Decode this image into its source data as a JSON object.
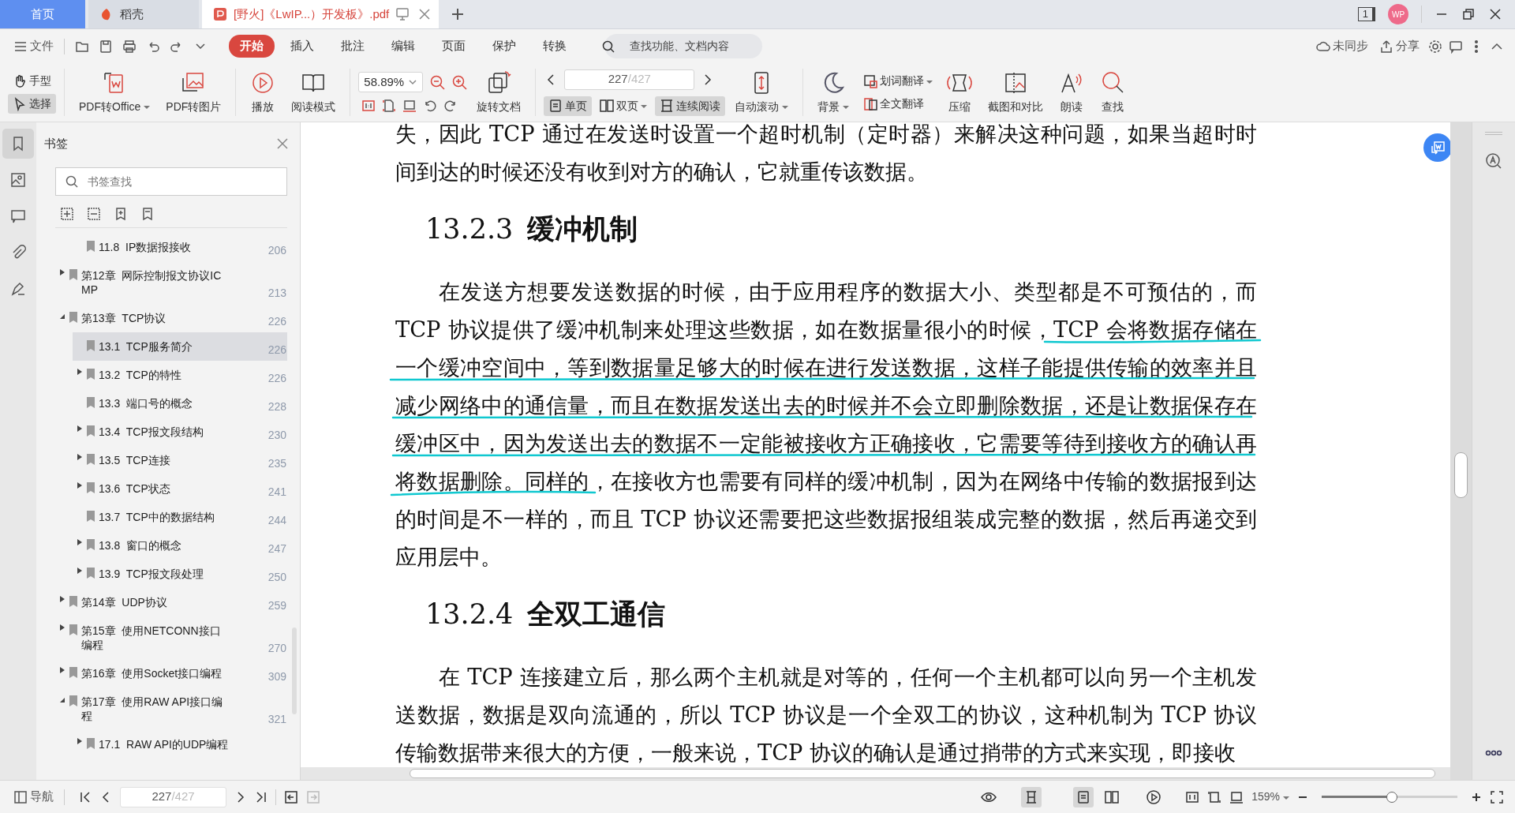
{
  "tabs": [
    {
      "label": "首页",
      "selected": false,
      "kind": "home"
    },
    {
      "label": "稻壳",
      "selected": false,
      "kind": "app"
    },
    {
      "label": "[野火]《LwIP...）开发板》.pdf",
      "selected": true,
      "kind": "pdf"
    }
  ],
  "title_bar": {
    "window_count": "1",
    "avatar": "WP"
  },
  "menu": {
    "file": "文件",
    "tabs": [
      {
        "label": "开始",
        "selected": true
      },
      {
        "label": "插入",
        "selected": false
      },
      {
        "label": "批注",
        "selected": false
      },
      {
        "label": "编辑",
        "selected": false
      },
      {
        "label": "页面",
        "selected": false
      },
      {
        "label": "保护",
        "selected": false
      },
      {
        "label": "转换",
        "selected": false
      }
    ],
    "search": {
      "placeholder": "查找功能、文档内容"
    },
    "sync": "未同步",
    "share": "分享"
  },
  "toolbar": {
    "modes": [
      {
        "label": "手型",
        "selected": false
      },
      {
        "label": "选择",
        "selected": true
      }
    ],
    "actions": [
      {
        "label": "PDF转Office",
        "dropdown": true
      },
      {
        "label": "PDF转图片",
        "dropdown": false
      },
      {
        "label": "播放",
        "dropdown": false
      },
      {
        "label": "阅读模式",
        "dropdown": false
      }
    ],
    "zoom": "58.89%",
    "rotate": "旋转文档",
    "page": {
      "current": "227",
      "total": "/427"
    },
    "views": [
      {
        "label": "单页",
        "selected": true,
        "dropdown": false
      },
      {
        "label": "双页",
        "selected": false,
        "dropdown": true
      },
      {
        "label": "连续阅读",
        "selected": true,
        "dropdown": false
      }
    ],
    "tools": [
      {
        "label": "自动滚动",
        "dropdown": true
      },
      {
        "label": "背景",
        "dropdown": true
      }
    ],
    "translate": [
      {
        "label": "划词翻译",
        "dropdown": true
      },
      {
        "label": "全文翻译",
        "dropdown": false
      }
    ],
    "extras": [
      {
        "label": "压缩"
      },
      {
        "label": "截图和对比"
      },
      {
        "label": "朗读"
      },
      {
        "label": "查找"
      }
    ]
  },
  "rail": [
    {
      "selected": true
    },
    {
      "selected": false
    },
    {
      "selected": false
    },
    {
      "selected": false
    },
    {
      "selected": false
    }
  ],
  "sidebar": {
    "title": "书签",
    "search": {
      "placeholder": "书签查找"
    },
    "orphan_items": [
      {
        "label": "11.8  IP数据报接收",
        "page": "206",
        "selected": false
      }
    ],
    "items": [
      {
        "label": "第12章  网际控制报文协议ICMP",
        "page": "213",
        "selected": false,
        "expanded": false
      },
      {
        "label": "第13章  TCP协议",
        "page": "226",
        "selected": false,
        "expanded": true,
        "children": [
          {
            "label": "13.1  TCP服务简介",
            "page": "226",
            "selected": true
          },
          {
            "label": "13.2  TCP的特性",
            "page": "226",
            "selected": false,
            "expanded": false
          },
          {
            "label": "13.3  端口号的概念",
            "page": "228",
            "selected": false
          },
          {
            "label": "13.4  TCP报文段结构",
            "page": "230",
            "selected": false,
            "expanded": false
          },
          {
            "label": "13.5  TCP连接",
            "page": "235",
            "selected": false,
            "expanded": false
          },
          {
            "label": "13.6  TCP状态",
            "page": "241",
            "selected": false,
            "expanded": false
          },
          {
            "label": "13.7  TCP中的数据结构",
            "page": "244",
            "selected": false
          },
          {
            "label": "13.8  窗口的概念",
            "page": "247",
            "selected": false,
            "expanded": false
          },
          {
            "label": "13.9  TCP报文段处理",
            "page": "250",
            "selected": false,
            "expanded": false
          }
        ]
      },
      {
        "label": "第14章  UDP协议",
        "page": "259",
        "selected": false,
        "expanded": false
      },
      {
        "label": "第15章  使用NETCONN接口编程",
        "page": "270",
        "selected": false,
        "expanded": false
      },
      {
        "label": "第16章  使用Socket接口编程",
        "page": "309",
        "selected": false,
        "expanded": false
      },
      {
        "label": "第17章  使用RAW API接口编程",
        "page": "321",
        "selected": false,
        "expanded": true,
        "children": [
          {
            "label": "17.1  RAW API的UDP编程",
            "selected": false,
            "expanded": false
          }
        ]
      }
    ]
  },
  "document": {
    "blocks": [
      {
        "kind": "paragraph",
        "indent": false,
        "inked": false,
        "text": "失，因此 TCP 通过在发送时设置一个超时机制（定时器）来解决这种问题，如果当超时时间到达的时候还没有收到对方的确认，它就重传该数据。"
      },
      {
        "kind": "heading",
        "number": "13.2.3",
        "text": "缓冲机制"
      },
      {
        "kind": "paragraph",
        "indent": true,
        "inked": true,
        "text": "在发送方想要发送数据的时候，由于应用程序的数据大小、类型都是不可预估的，而 TCP 协议提供了缓冲机制来处理这些数据，如在数据量很小的时候，TCP 会将数据存储在一个缓冲空间中，等到数据量足够大的时候在进行发送数据，这样子能提供传输的效率并且减少网络中的通信量，而且在数据发送出去的时候并不会立即删除数据，还是让数据保存在缓冲区中，因为发送出去的数据不一定能被接收方正确接收，它需要等待到接收方的确认再将数据删除。同样的，在接收方也需要有同样的缓冲机制，因为在网络中传输的数据报到达的时间是不一样的，而且 TCP 协议还需要把这些数据报组装成完整的数据，然后再递交到应用层中。"
      },
      {
        "kind": "heading",
        "number": "13.2.4",
        "text": "全双工通信"
      },
      {
        "kind": "paragraph",
        "indent": true,
        "inked": false,
        "text": "在 TCP 连接建立后，那么两个主机就是对等的，任何一个主机都可以向另一个主机发送数据，数据是双向流通的，所以 TCP 协议是一个全双工的协议，这种机制为 TCP 协议传输数据带来很大的方便，一般来说，TCP 协议的确认是通过捎带的方式来实现，即接收"
      }
    ]
  },
  "status_bar": {
    "nav": "导航",
    "page": {
      "current": "227",
      "total": "/427"
    },
    "views": [
      {
        "selected": true
      },
      {
        "selected": true
      },
      {
        "selected": false
      }
    ],
    "zoom": "159%",
    "zoom_slider": {
      "level": 0.52
    }
  }
}
